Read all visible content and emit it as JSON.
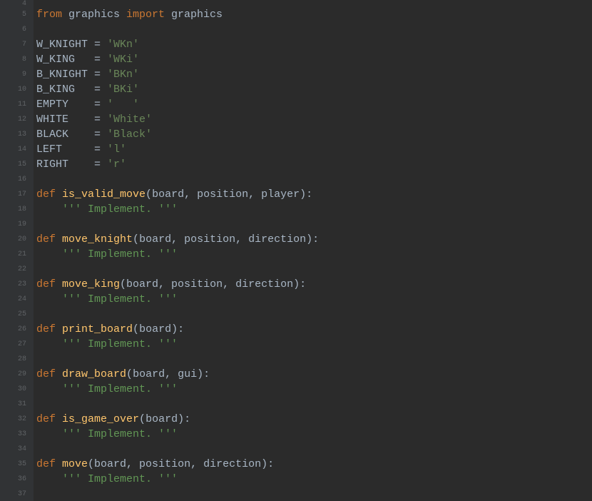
{
  "gutter_start": 4,
  "gutter_end": 37,
  "code": {
    "l5": {
      "from_kw": "from",
      "mod1": " graphics ",
      "import_kw": "import",
      "mod2": " graphics"
    },
    "consts": {
      "w_knight": {
        "name": "W_KNIGHT ",
        "eq": "=",
        "val": " 'WKn'"
      },
      "w_king": {
        "name": "W_KING   ",
        "eq": "=",
        "val": " 'WKi'"
      },
      "b_knight": {
        "name": "B_KNIGHT ",
        "eq": "=",
        "val": " 'BKn'"
      },
      "b_king": {
        "name": "B_KING   ",
        "eq": "=",
        "val": " 'BKi'"
      },
      "empty": {
        "name": "EMPTY    ",
        "eq": "=",
        "val": " '   '"
      },
      "white": {
        "name": "WHITE    ",
        "eq": "=",
        "val": " 'White'"
      },
      "black": {
        "name": "BLACK    ",
        "eq": "=",
        "val": " 'Black'"
      },
      "left": {
        "name": "LEFT     ",
        "eq": "=",
        "val": " 'l'"
      },
      "right": {
        "name": "RIGHT    ",
        "eq": "=",
        "val": " 'r'"
      }
    },
    "funcs": {
      "def_kw": "def",
      "doc": "    ''' Implement. '''",
      "is_valid_move": {
        "name": " is_valid_move",
        "sig_open": "(",
        "p": "board, position, player",
        "sig_close": "):"
      },
      "move_knight": {
        "name": " move_knight",
        "sig_open": "(",
        "p": "board, position, direction",
        "sig_close": "):"
      },
      "move_king": {
        "name": " move_king",
        "sig_open": "(",
        "p": "board, position, direction",
        "sig_close": "):"
      },
      "print_board": {
        "name": " print_board",
        "sig_open": "(",
        "p": "board",
        "sig_close": "):"
      },
      "draw_board": {
        "name": " draw_board",
        "sig_open": "(",
        "p": "board, gui",
        "sig_close": "):"
      },
      "is_game_over": {
        "name": " is_game_over",
        "sig_open": "(",
        "p": "board",
        "sig_close": "):"
      },
      "move": {
        "name": " move",
        "sig_open": "(",
        "p": "board, position, direction",
        "sig_close": "):"
      }
    }
  }
}
